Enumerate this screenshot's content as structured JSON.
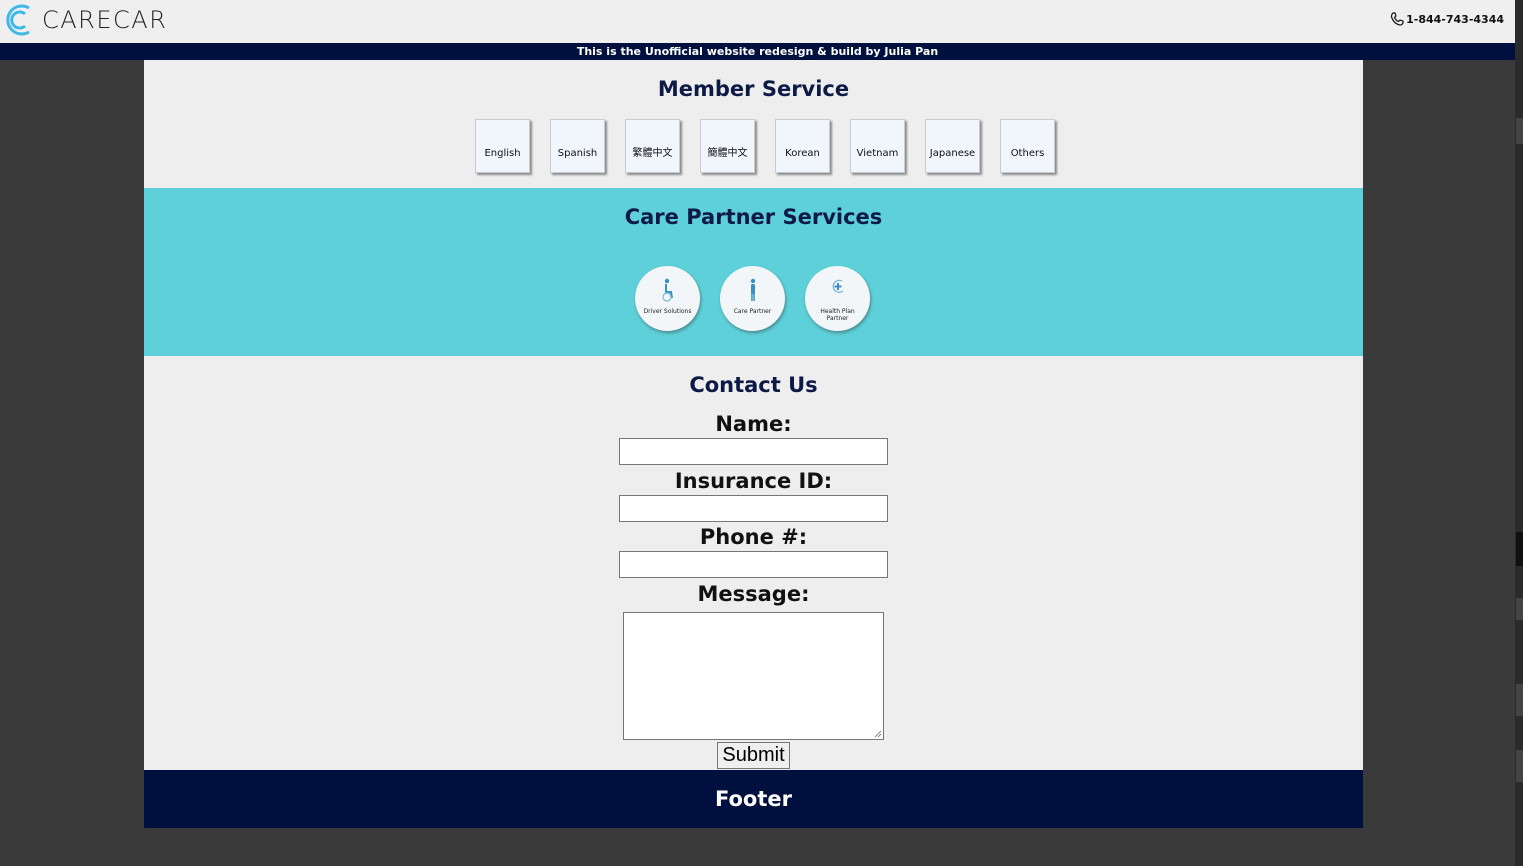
{
  "header": {
    "logo_text": "CARECAR",
    "phone": "1-844-743-4344"
  },
  "banner": {
    "text": "This is the Unofficial website redesign & build by Julia Pan"
  },
  "member_service": {
    "title": "Member Service",
    "languages": [
      "English",
      "Spanish",
      "繁體中文",
      "簡體中文",
      "Korean",
      "Vietnam",
      "Japanese",
      "Others"
    ]
  },
  "care_partner": {
    "title": "Care Partner Services",
    "services": [
      {
        "label": "Driver Solutions",
        "icon": "wheelchair-person-icon"
      },
      {
        "label": "Care Partner",
        "icon": "standing-person-icon"
      },
      {
        "label": "Health Plan Partner",
        "icon": "health-plus-icon"
      }
    ]
  },
  "contact": {
    "title": "Contact Us",
    "name_label": "Name:",
    "name_value": "",
    "insurance_label": "Insurance ID:",
    "insurance_value": "",
    "phone_label": "Phone #:",
    "phone_value": "",
    "message_label": "Message:",
    "message_value": "",
    "submit_label": "Submit"
  },
  "footer": {
    "text": "Footer"
  },
  "colors": {
    "navy": "#00103e",
    "teal": "#5ed0d9",
    "light_gray": "#eeeeee",
    "logo_blue": "#3fb8e6"
  }
}
